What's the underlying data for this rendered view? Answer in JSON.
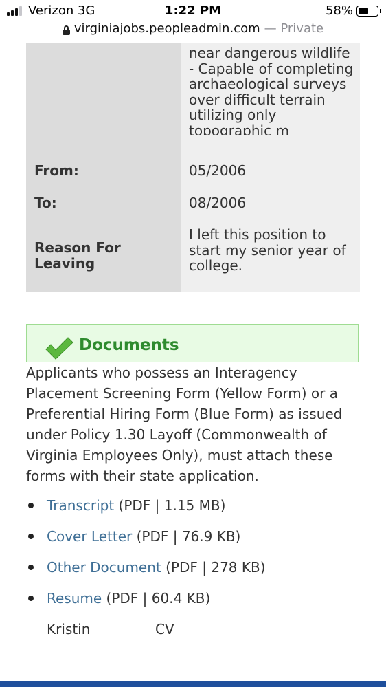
{
  "status_bar": {
    "carrier": "Verizon 3G",
    "time": "1:22 PM",
    "battery_percent": "58%",
    "battery_level": 0.58,
    "signal_bars_active": 3
  },
  "url_bar": {
    "domain": "virginiajobs.peopleadmin.com",
    "private_label": "— Private"
  },
  "work_experience": {
    "duties_tail": [
      "near dangerous wildlife",
      "- Capable of completing",
      "archaeological surveys",
      "over difficult terrain",
      "utilizing only",
      "topographic m"
    ],
    "rows": [
      {
        "label": "From:",
        "value": "05/2006"
      },
      {
        "label": "To:",
        "value": "08/2006"
      },
      {
        "label": "Reason For Leaving",
        "value": "I left this position to start my senior year of college."
      }
    ]
  },
  "documents": {
    "title": "Documents",
    "description": "Applicants who possess an Interagency Placement Screening Form (Yellow Form) or a Preferential Hiring Form (Blue Form) as issued under Policy 1.30 Layoff (Commonwealth of Virginia Employees Only), must attach these forms with their state application.",
    "items": [
      {
        "name": "Transcript",
        "meta": "(PDF | 1.15 MB)"
      },
      {
        "name": "Cover Letter",
        "meta": "(PDF | 76.9 KB)"
      },
      {
        "name": "Other Document",
        "meta": "(PDF | 278 KB)"
      },
      {
        "name": "Resume",
        "meta": "(PDF | 60.4 KB)"
      }
    ],
    "subnote_first": "Kristin",
    "subnote_second": "CV"
  },
  "colors": {
    "link": "#3f6f96",
    "docs_title": "#2e8b2e",
    "docs_box_bg": "#e8fbe4",
    "check_green": "#5cb83f",
    "bottom_bar": "#1f4f9c"
  }
}
